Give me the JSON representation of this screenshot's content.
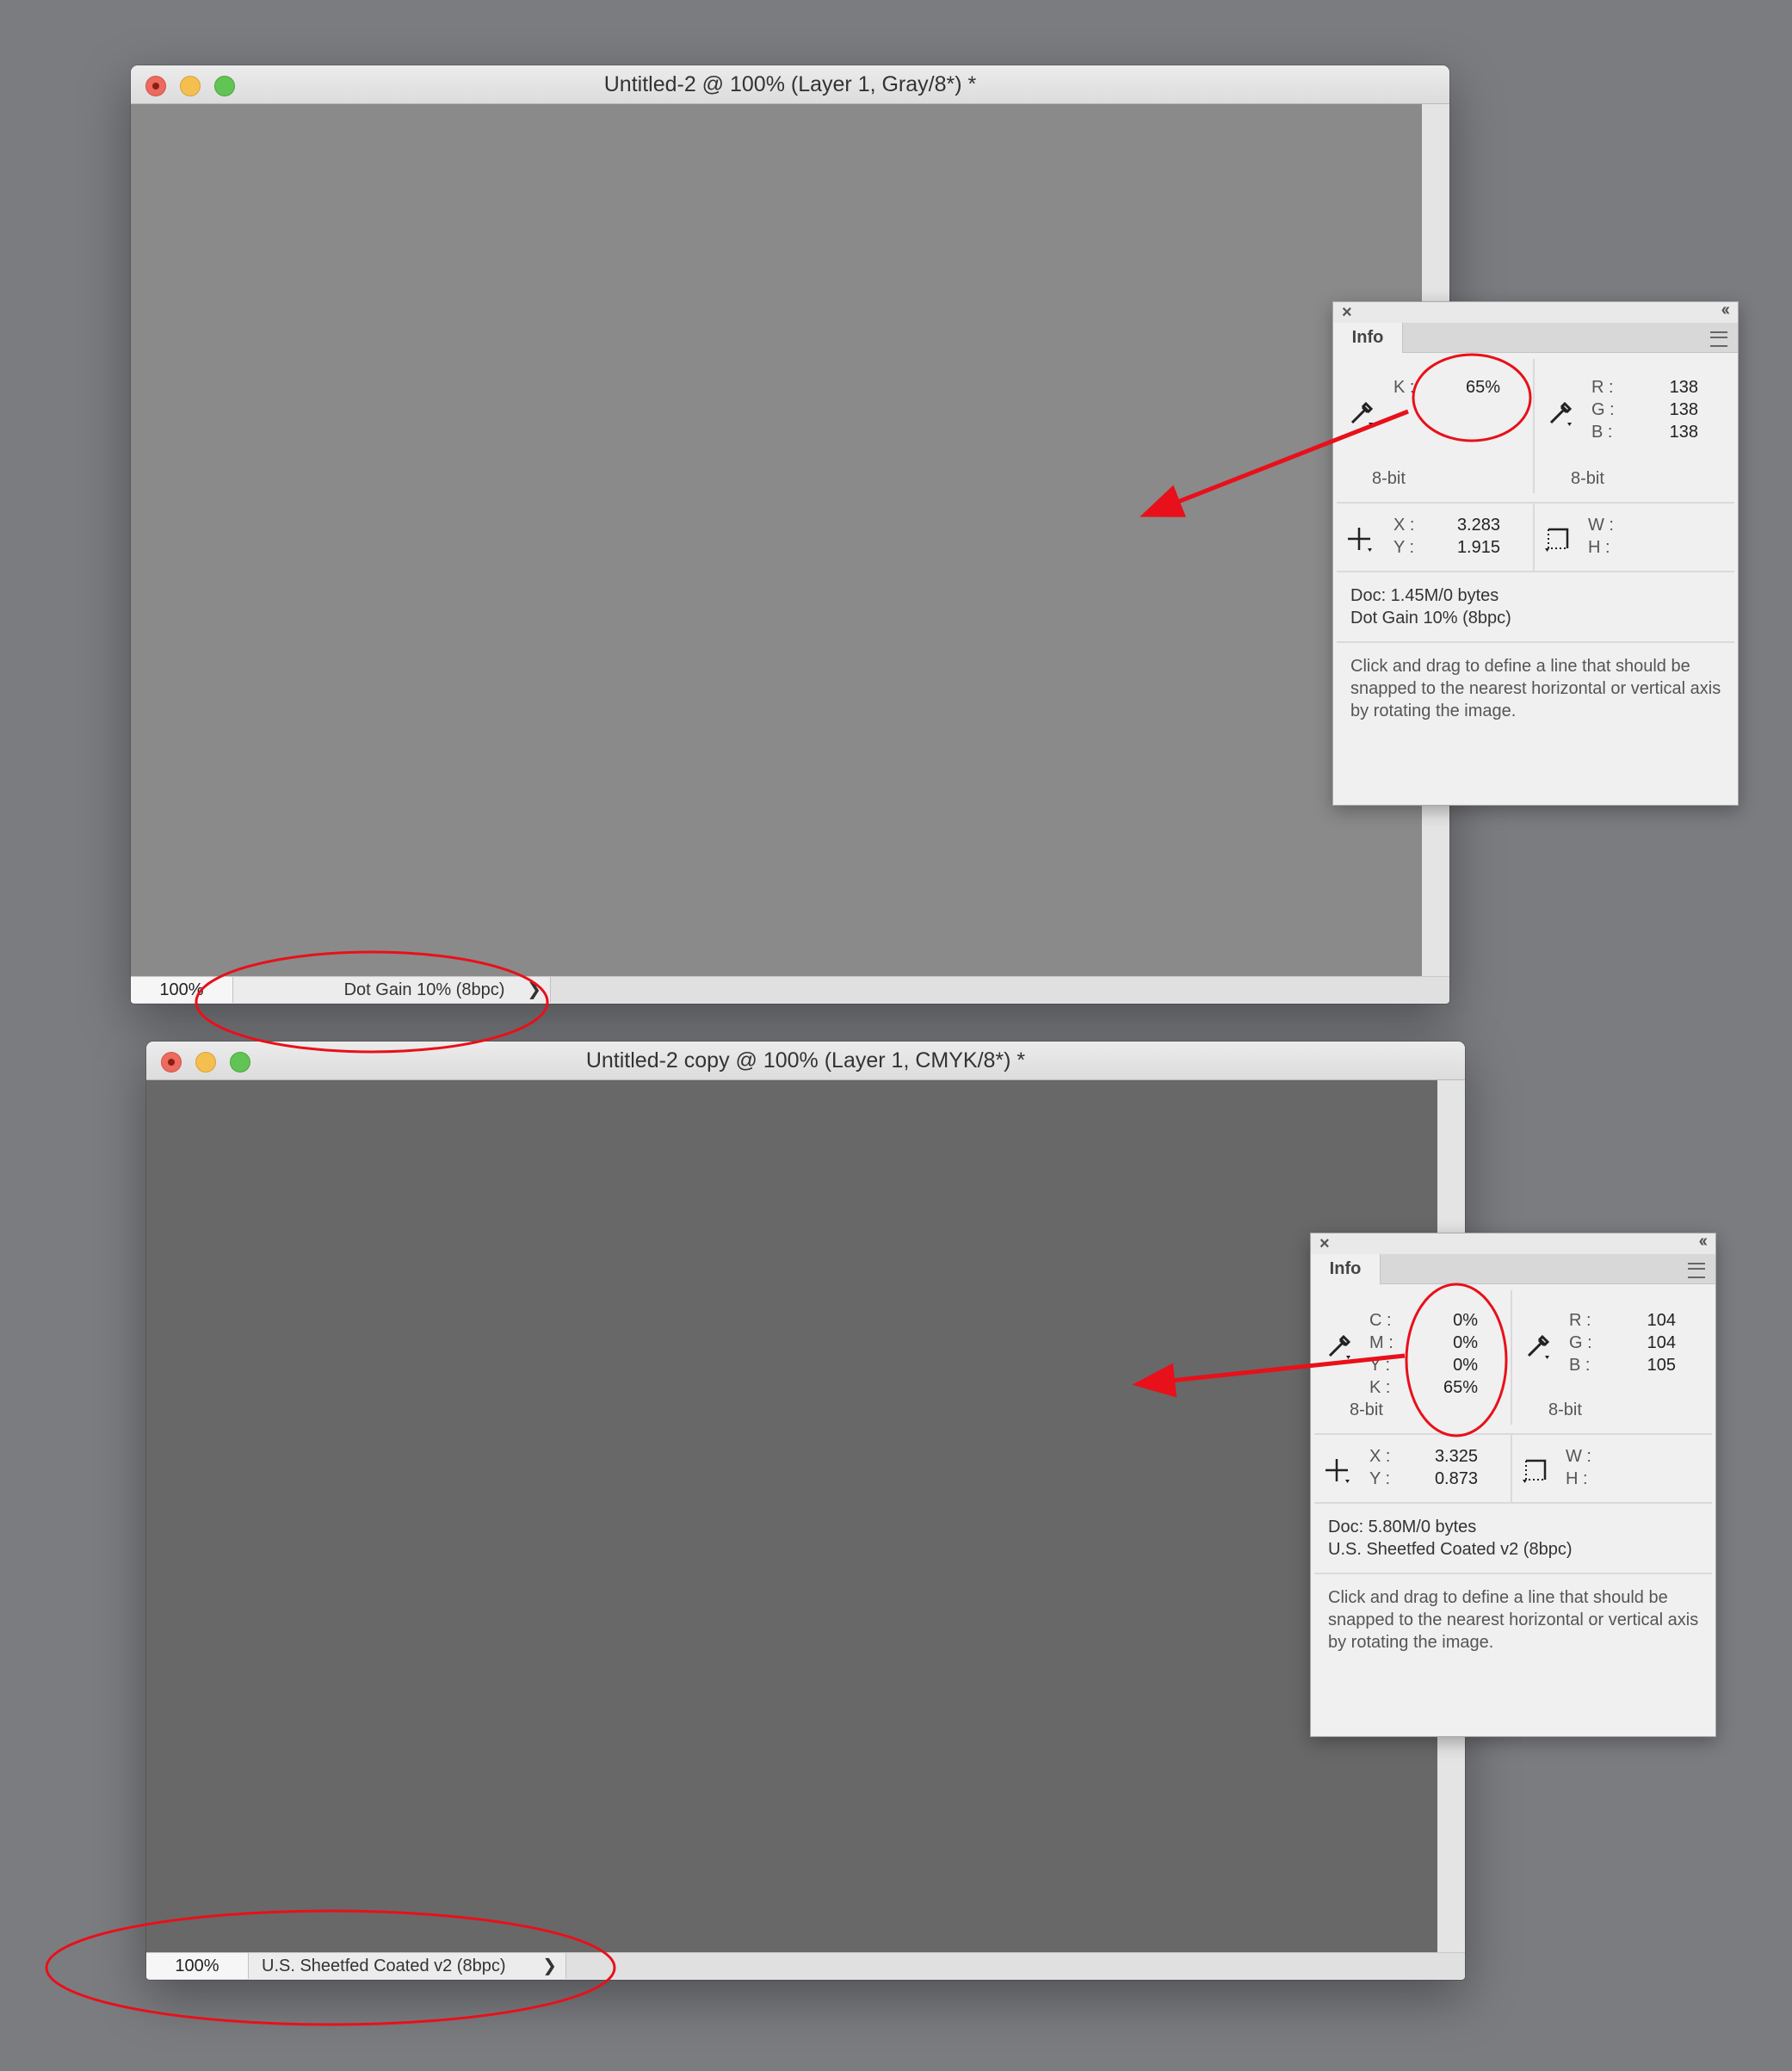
{
  "colors": {
    "desktop": "#7b7c80",
    "canvas_top": "#8a8a8a",
    "canvas_bottom": "#686868",
    "annotation": "#e8101a"
  },
  "window_top": {
    "title": "Untitled-2 @ 100% (Layer 1, Gray/8*) *",
    "status_zoom": "100%",
    "status_doc": "Dot Gain 10% (8bpc)",
    "status_chevron": "❯"
  },
  "window_bottom": {
    "title": "Untitled-2 copy @ 100% (Layer 1, CMYK/8*) *",
    "status_zoom": "100%",
    "status_doc": "U.S. Sheetfed Coated v2 (8bpc)",
    "status_chevron": "❯"
  },
  "panel_top": {
    "close": "×",
    "collapse": "‹‹",
    "tab": "Info",
    "first_readout": {
      "rows": [
        {
          "label": "K :",
          "value": "65%"
        }
      ],
      "bit_depth": "8-bit"
    },
    "second_readout": {
      "rows": [
        {
          "label": "R :",
          "value": "138"
        },
        {
          "label": "G :",
          "value": "138"
        },
        {
          "label": "B :",
          "value": "138"
        }
      ],
      "bit_depth": "8-bit"
    },
    "position": {
      "x_label": "X :",
      "x_value": "3.283",
      "y_label": "Y :",
      "y_value": "1.915"
    },
    "size": {
      "w_label": "W :",
      "h_label": "H :"
    },
    "doc_line1": "Doc: 1.45M/0 bytes",
    "doc_line2": "Dot Gain 10% (8bpc)",
    "help": "Click and drag to define a line that should be snapped to the nearest horizontal or vertical axis by rotating the image."
  },
  "panel_bottom": {
    "close": "×",
    "collapse": "‹‹",
    "tab": "Info",
    "first_readout": {
      "rows": [
        {
          "label": "C :",
          "value": "0%"
        },
        {
          "label": "M :",
          "value": "0%"
        },
        {
          "label": "Y :",
          "value": "0%"
        },
        {
          "label": "K :",
          "value": "65%"
        }
      ],
      "bit_depth": "8-bit"
    },
    "second_readout": {
      "rows": [
        {
          "label": "R :",
          "value": "104"
        },
        {
          "label": "G :",
          "value": "104"
        },
        {
          "label": "B :",
          "value": "105"
        }
      ],
      "bit_depth": "8-bit"
    },
    "position": {
      "x_label": "X :",
      "x_value": "3.325",
      "y_label": "Y :",
      "y_value": "0.873"
    },
    "size": {
      "w_label": "W :",
      "h_label": "H :"
    },
    "doc_line1": "Doc: 5.80M/0 bytes",
    "doc_line2": "U.S. Sheetfed Coated v2 (8bpc)",
    "help": "Click and drag to define a line that should be snapped to the nearest horizontal or vertical axis by rotating the image."
  }
}
